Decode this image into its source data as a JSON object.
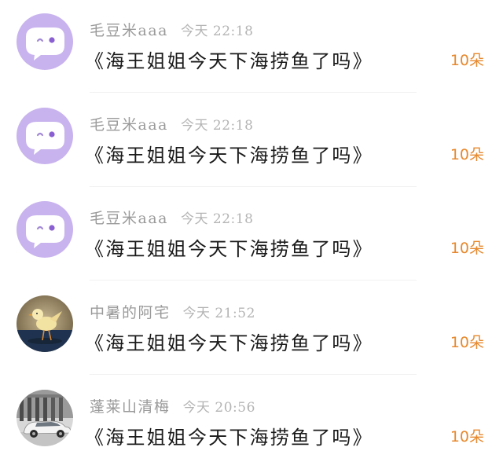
{
  "colors": {
    "username": "#9a9a9a",
    "time": "#b4b4b4",
    "message": "#1a1a1a",
    "gift": "#e7892e",
    "default_avatar_bg": "#c8b3ee"
  },
  "comments": [
    {
      "avatar": "default-purple-face-icon",
      "username": "毛豆米aaa",
      "time": "今天 22:18",
      "message": "《海王姐姐今天下海捞鱼了吗》",
      "gift": "10朵"
    },
    {
      "avatar": "default-purple-face-icon",
      "username": "毛豆米aaa",
      "time": "今天 22:18",
      "message": "《海王姐姐今天下海捞鱼了吗》",
      "gift": "10朵"
    },
    {
      "avatar": "default-purple-face-icon",
      "username": "毛豆米aaa",
      "time": "今天 22:18",
      "message": "《海王姐姐今天下海捞鱼了吗》",
      "gift": "10朵"
    },
    {
      "avatar": "chick-photo-avatar",
      "username": "中暑的阿宅",
      "time": "今天 21:52",
      "message": "《海王姐姐今天下海捞鱼了吗》",
      "gift": "10朵"
    },
    {
      "avatar": "car-photo-avatar",
      "username": "蓬莱山清梅",
      "time": "今天 20:56",
      "message": "《海王姐姐今天下海捞鱼了吗》",
      "gift": "10朵"
    }
  ]
}
